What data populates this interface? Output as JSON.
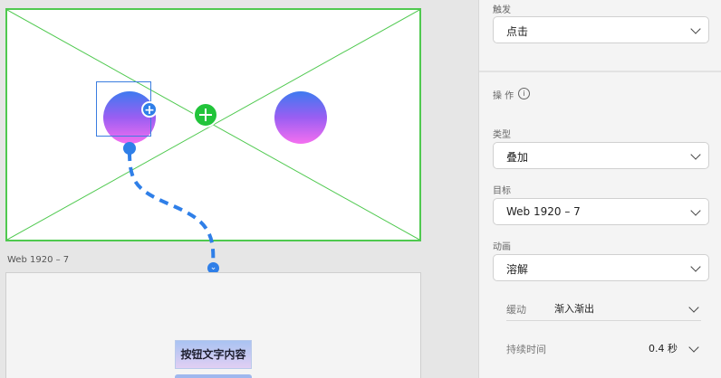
{
  "panel": {
    "trigger_label": "触发",
    "trigger_value": "点击",
    "action_label": "操 作",
    "info_icon": "info-icon",
    "type_label": "类型",
    "type_value": "叠加",
    "target_label": "目标",
    "target_value": "Web 1920 – 7",
    "animation_label": "动画",
    "animation_value": "溶解",
    "easing_label": "缓动",
    "easing_value": "渐入渐出",
    "duration_label": "持续时间",
    "duration_value": "0.4 秒"
  },
  "canvas": {
    "artboard2_label": "Web 1920 – 7",
    "button_text": "按钮文字内容",
    "add_symbol": "+",
    "end_symbol": "⌄",
    "accent_blue": "#2f7fe8",
    "accent_green": "#21c43a"
  }
}
